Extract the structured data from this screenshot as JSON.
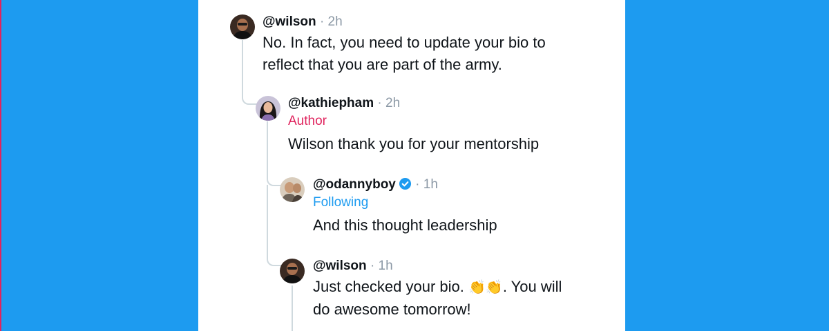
{
  "thread": {
    "comments": [
      {
        "handle": "@wilson",
        "separator": "·",
        "time": "2h",
        "text_line1": "No. In fact, you need to update your bio to",
        "text_line2": "reflect that you are part of the army.",
        "avatar": "wilson-avatar"
      },
      {
        "handle": "@kathiepham",
        "separator": "·",
        "time": "2h",
        "badge": "Author",
        "text": "Wilson thank you for your mentorship",
        "avatar": "kathiepham-avatar"
      },
      {
        "handle": "@odannyboy",
        "verified": "verified-badge-icon",
        "separator": "·",
        "time": "1h",
        "badge": "Following",
        "text": "And this thought leadership",
        "avatar": "odannyboy-avatar"
      },
      {
        "handle": "@wilson",
        "separator": "·",
        "time": "1h",
        "text_part1": "Just checked your bio. ",
        "emoji": "👏👏",
        "text_part2": ". You will",
        "text_line2": "do awesome tomorrow!",
        "avatar": "wilson-avatar"
      }
    ]
  },
  "colors": {
    "background": "#1d9bf0",
    "author_badge": "#e0245e",
    "following_badge": "#1d9bf0",
    "meta_gray": "#8b98a5"
  }
}
